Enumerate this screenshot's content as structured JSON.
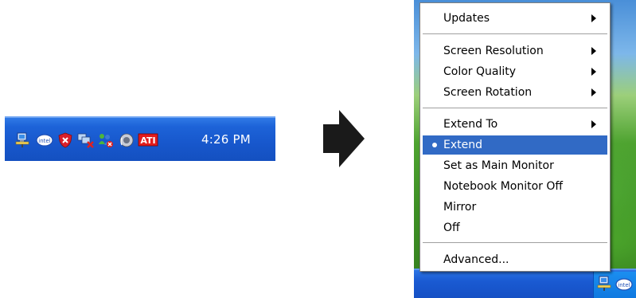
{
  "tray": {
    "icons": [
      "network-connection-icon",
      "intel-graphics-icon",
      "security-shield-icon",
      "network-disconnected-icon",
      "msn-messenger-icon",
      "speaker-volume-icon",
      "ati-catalyst-icon"
    ],
    "ati_label": "ATI",
    "clock": "4:26 PM"
  },
  "context_menu": {
    "items": [
      {
        "label": "Updates",
        "has_submenu": true
      },
      {
        "label": "Screen Resolution",
        "has_submenu": true
      },
      {
        "label": "Color Quality",
        "has_submenu": true
      },
      {
        "label": "Screen Rotation",
        "has_submenu": true
      },
      {
        "label": "Extend To",
        "has_submenu": true
      },
      {
        "label": "Extend",
        "selected": true,
        "checked": true
      },
      {
        "label": "Set as Main Monitor"
      },
      {
        "label": "Notebook Monitor Off"
      },
      {
        "label": "Mirror"
      },
      {
        "label": "Off"
      },
      {
        "label": "Advanced..."
      }
    ],
    "highlight_color": "#316ac5"
  },
  "taskbar": {
    "notification_icons": [
      "network-connection-icon",
      "intel-graphics-icon"
    ],
    "intel_label": "intel"
  },
  "colors": {
    "taskbar_blue": "#1757cc",
    "desktop_green": "#4ea330"
  }
}
